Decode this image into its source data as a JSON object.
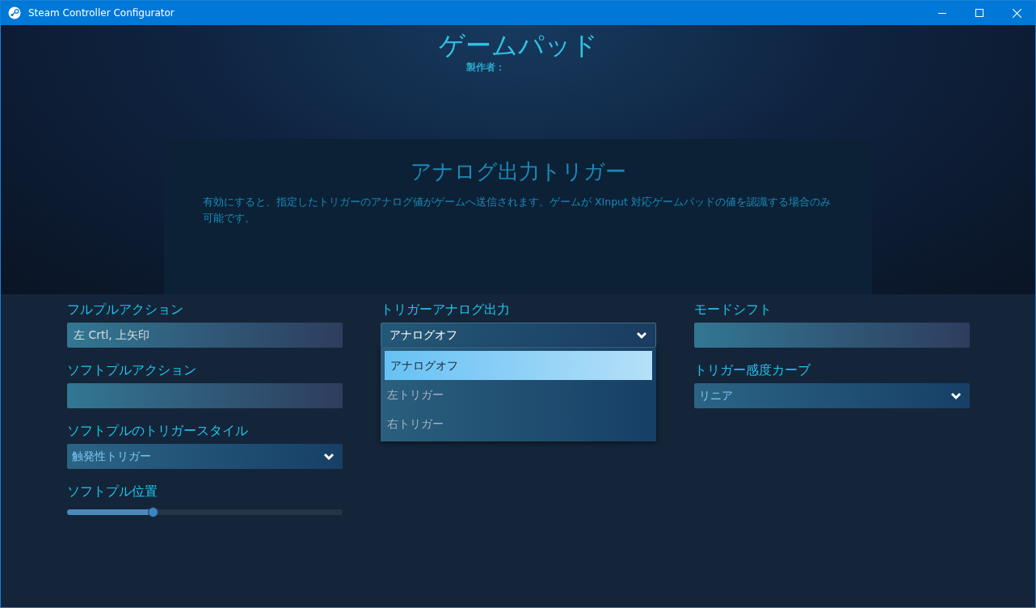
{
  "window": {
    "title": "Steam Controller Configurator"
  },
  "header": {
    "title": "ゲームパッド",
    "author_label": "製作者："
  },
  "info_panel": {
    "title": "アナログ出力トリガー",
    "description": "有効にすると、指定したトリガーのアナログ値がゲームへ送信されます。ゲームが XInput 対応ゲームパッドの値を認識する場合のみ可能です。"
  },
  "columns": [
    [
      {
        "kind": "binding",
        "label": "フルプルアクション",
        "value": "左 Crtl, 上矢印"
      },
      {
        "kind": "binding",
        "label": "ソフトプルアクション"
      },
      {
        "kind": "dropdown",
        "label": "ソフトプルのトリガースタイル",
        "value": "触発性トリガー",
        "expanded": false
      },
      {
        "kind": "slider",
        "label": "ソフトプル位置",
        "level": 0.31
      }
    ],
    [
      {
        "kind": "dropdown",
        "label": "トリガーアナログ出力",
        "value": "アナログオフ",
        "expanded": true,
        "options": [
          {
            "label": "アナログオフ",
            "selected": true
          },
          {
            "label": "左トリガー",
            "selected": false
          },
          {
            "label": "右トリガー",
            "selected": false
          }
        ]
      }
    ],
    [
      {
        "kind": "binding",
        "label": "モードシフト"
      },
      {
        "kind": "dropdown",
        "label": "トリガー感度カーブ",
        "value": "リニア",
        "expanded": false
      }
    ]
  ]
}
